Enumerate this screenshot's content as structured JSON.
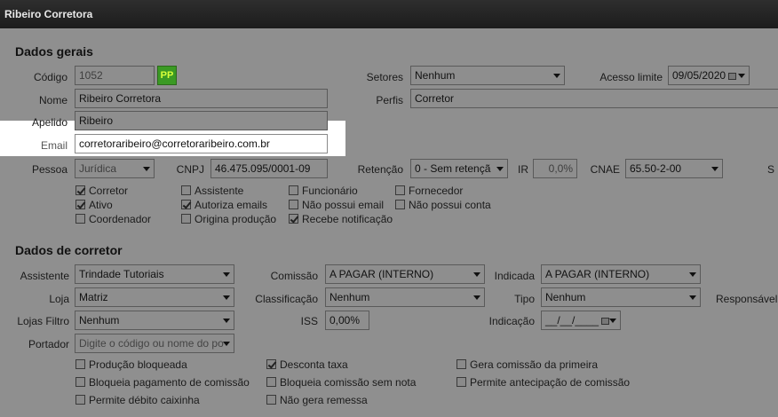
{
  "window": {
    "title": "Ribeiro Corretora"
  },
  "general": {
    "section_title": "Dados gerais",
    "codigo_label": "Código",
    "codigo_value": "1052",
    "pp_badge": "PP",
    "nome_label": "Nome",
    "nome_value": "Ribeiro Corretora",
    "apelido_label": "Apelido",
    "apelido_value": "Ribeiro",
    "email_label": "Email",
    "email_value": "corretoraribeiro@corretoraribeiro.com.br",
    "pessoa_label": "Pessoa",
    "pessoa_value": "Jurídica",
    "cnpj_label": "CNPJ",
    "cnpj_value": "46.475.095/0001-09",
    "setores_label": "Setores",
    "setores_value": "Nenhum",
    "acesso_label": "Acesso limite",
    "acesso_value": "09/05/2020",
    "perfis_label": "Perfis",
    "perfis_value": "Corretor",
    "retencao_label": "Retenção",
    "retencao_value": "0 - Sem retençã",
    "ir_label": "IR",
    "ir_value": "0,0%",
    "cnae_label": "CNAE",
    "cnae_value": "65.50-2-00",
    "cut_label": "S"
  },
  "flags": [
    {
      "label": "Corretor",
      "checked": true
    },
    {
      "label": "Ativo",
      "checked": true
    },
    {
      "label": "Coordenador",
      "checked": false
    },
    {
      "label": "Assistente",
      "checked": false
    },
    {
      "label": "Autoriza emails",
      "checked": true
    },
    {
      "label": "Origina produção",
      "checked": false
    },
    {
      "label": "Funcionário",
      "checked": false
    },
    {
      "label": "Não possui email",
      "checked": false
    },
    {
      "label": "Recebe notificação",
      "checked": true
    },
    {
      "label": "Fornecedor",
      "checked": false
    },
    {
      "label": "Não possui conta",
      "checked": false
    }
  ],
  "broker": {
    "section_title": "Dados de corretor",
    "assistente_label": "Assistente",
    "assistente_value": "Trindade Tutoriais",
    "loja_label": "Loja",
    "loja_value": "Matriz",
    "lojas_filtro_label": "Lojas Filtro",
    "lojas_filtro_value": "Nenhum",
    "portador_label": "Portador",
    "portador_placeholder": "Digite o código ou nome do po",
    "comissao_label": "Comissão",
    "comissao_value": "A PAGAR (INTERNO)",
    "classificacao_label": "Classificação",
    "classificacao_value": "Nenhum",
    "iss_label": "ISS",
    "iss_value": "0,00%",
    "indicada_label": "Indicada",
    "indicada_value": "A PAGAR (INTERNO)",
    "tipo_label": "Tipo",
    "tipo_value": "Nenhum",
    "indicacao_label": "Indicação",
    "indicacao_value": "__/__/____",
    "responsavel_label": "Responsável"
  },
  "broker_flags": [
    {
      "label": "Produção bloqueada",
      "checked": false
    },
    {
      "label": "Bloqueia pagamento de comissão",
      "checked": false
    },
    {
      "label": "Permite débito caixinha",
      "checked": false
    },
    {
      "label": "Desconta taxa",
      "checked": true
    },
    {
      "label": "Bloqueia comissão sem nota",
      "checked": false
    },
    {
      "label": "Não gera remessa",
      "checked": false
    },
    {
      "label": "Gera comissão da primeira",
      "checked": false
    },
    {
      "label": "Permite antecipação de comissão",
      "checked": false
    }
  ]
}
